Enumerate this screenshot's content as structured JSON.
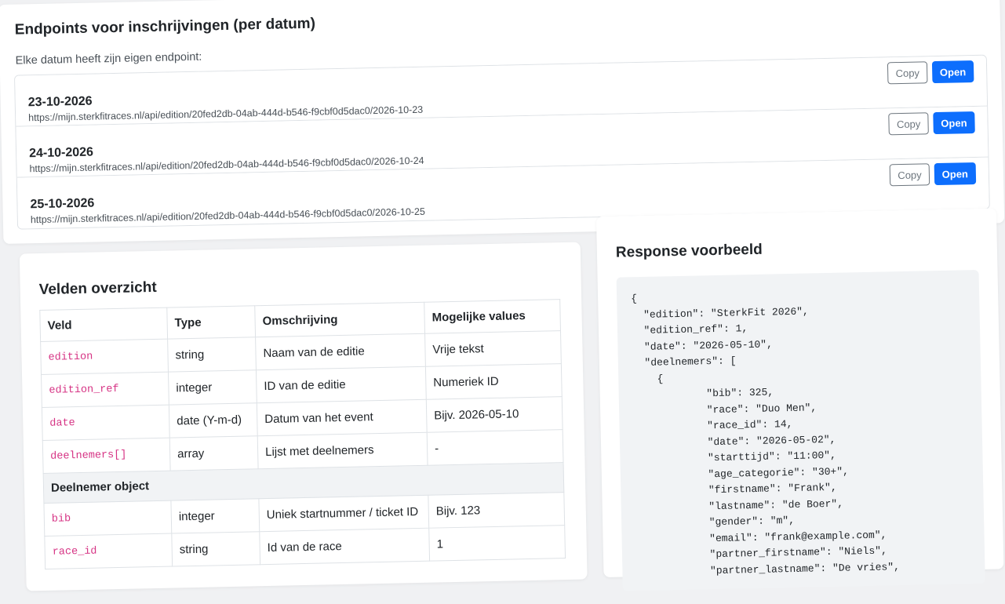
{
  "endpoints_section": {
    "title": "Endpoints voor inschrijvingen (per datum)",
    "description": "Elke datum heeft zijn eigen endpoint:",
    "copy_label": "Copy",
    "open_label": "Open",
    "items": [
      {
        "date": "23-10-2026",
        "url": "https://mijn.sterkfitraces.nl/api/edition/20fed2db-04ab-444d-b546-f9cbf0d5dac0/2026-10-23"
      },
      {
        "date": "24-10-2026",
        "url": "https://mijn.sterkfitraces.nl/api/edition/20fed2db-04ab-444d-b546-f9cbf0d5dac0/2026-10-24"
      },
      {
        "date": "25-10-2026",
        "url": "https://mijn.sterkfitraces.nl/api/edition/20fed2db-04ab-444d-b546-f9cbf0d5dac0/2026-10-25"
      }
    ]
  },
  "fields_section": {
    "title": "Velden overzicht",
    "headers": [
      "Veld",
      "Type",
      "Omschrijving",
      "Mogelijke values"
    ],
    "rows": [
      {
        "veld": "edition",
        "type": "string",
        "omschrijving": "Naam van de editie",
        "values": "Vrije tekst"
      },
      {
        "veld": "edition_ref",
        "type": "integer",
        "omschrijving": "ID van de editie",
        "values": "Numeriek ID"
      },
      {
        "veld": "date",
        "type": "date (Y-m-d)",
        "omschrijving": "Datum van het event",
        "values": "Bijv. 2026-05-10"
      },
      {
        "veld": "deelnemers[]",
        "type": "array",
        "omschrijving": "Lijst met deelnemers",
        "values": "-"
      }
    ],
    "group_label": "Deelnemer object",
    "group_rows": [
      {
        "veld": "bib",
        "type": "integer",
        "omschrijving": "Uniek startnummer / ticket ID",
        "values": "Bijv. 123"
      },
      {
        "veld": "race_id",
        "type": "string",
        "omschrijving": "Id van de race",
        "values": "1"
      }
    ]
  },
  "response_section": {
    "title": "Response voorbeeld",
    "code": "{\n  \"edition\": \"SterkFit 2026\",\n  \"edition_ref\": 1,\n  \"date\": \"2026-05-10\",\n  \"deelnemers\": [\n    {\n            \"bib\": 325,\n            \"race\": \"Duo Men\",\n            \"race_id\": 14,\n            \"date\": \"2026-05-02\",\n            \"starttijd\": \"11:00\",\n            \"age_categorie\": \"30+\",\n            \"firstname\": \"Frank\",\n            \"lastname\": \"de Boer\",\n            \"gender\": \"m\",\n            \"email\": \"frank@example.com\",\n            \"partner_firstname\": \"Niels\",\n            \"partner_lastname\": \"De vries\","
  }
}
